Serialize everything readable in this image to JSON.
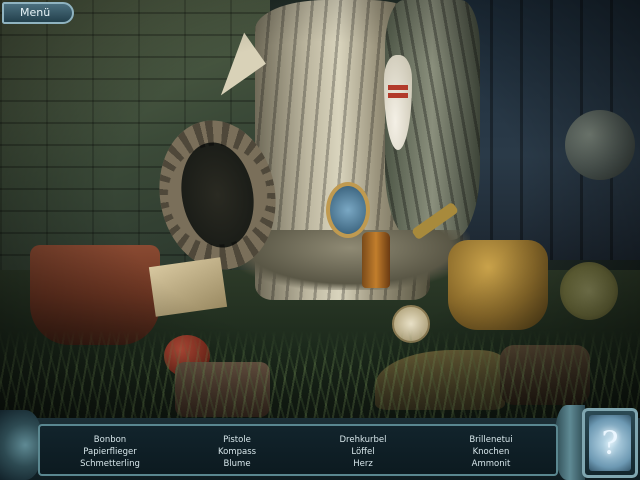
{
  "menu": {
    "label": "Menü"
  },
  "find_list": {
    "columns": [
      [
        "Bonbon",
        "Papierflieger",
        "Schmetterling"
      ],
      [
        "Pistole",
        "Kompass",
        "Blume"
      ],
      [
        "Drehkurbel",
        "Löffel",
        "Herz"
      ],
      [
        "Brillenetui",
        "Knochen",
        "Ammonit"
      ]
    ]
  },
  "hint": {
    "icon": "question-mark-icon",
    "glyph": "?"
  },
  "colors": {
    "panel_border": "#5a8790",
    "list_text": "#d7e6ea",
    "hint_glow": "#c8e4f2"
  }
}
